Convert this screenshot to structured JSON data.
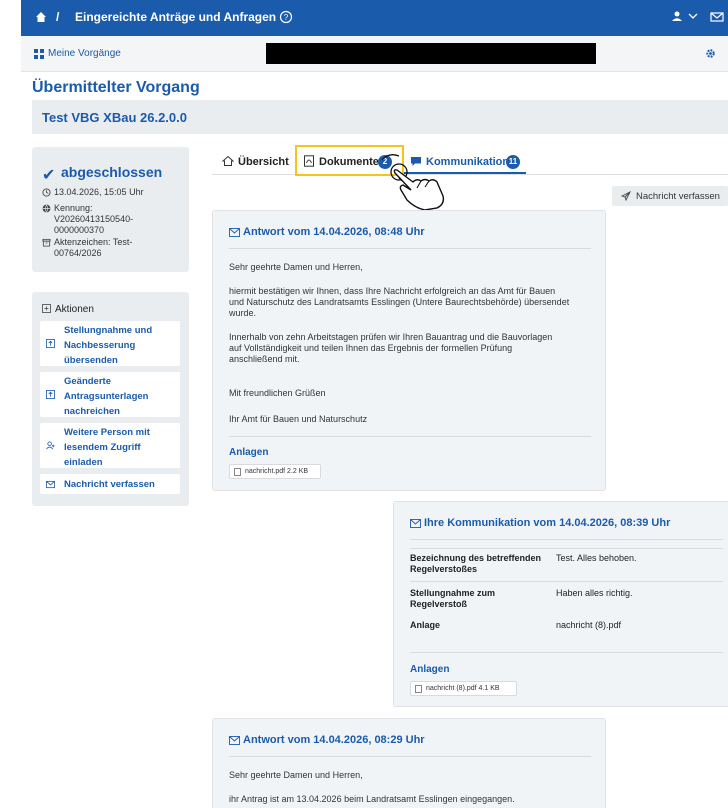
{
  "header": {
    "separator": "/",
    "breadcrumb": "Eingereichte Anträge und Anfragen"
  },
  "subnav": {
    "label": "Meine Vorgänge"
  },
  "page_title": "Übermittelter Vorgang",
  "vorgang_title": "Test VBG XBau 26.2.0.0",
  "status": {
    "label": "abgeschlossen",
    "date": "13.04.2026, 15:05 Uhr",
    "kennung": [
      "Kennung:",
      "V20260413150540-",
      "0000000370"
    ],
    "aktenzeichen": [
      "Aktenzeichen: Test-",
      "00764/2026"
    ]
  },
  "actions": {
    "title": "Aktionen",
    "items": [
      [
        "Stellungnahme und",
        "Nachbesserung",
        "übersenden"
      ],
      [
        "Geänderte",
        "Antragsunterlagen",
        "nachreichen"
      ],
      [
        "Weitere Person mit",
        "lesendem Zugriff",
        "einladen"
      ],
      [
        "Nachricht verfassen"
      ]
    ]
  },
  "tabs": {
    "overview": "Übersicht",
    "documents": "Dokumente",
    "documents_count": "2",
    "communication": "Kommunikation",
    "communication_count": "11"
  },
  "compose_button": "Nachricht verfassen",
  "messages": {
    "m1": {
      "title": "Antwort vom 14.04.2026, 08:48 Uhr",
      "lines": [
        "Sehr geehrte Damen und Herren,",
        "hiermit bestätigen wir Ihnen, dass Ihre Nachricht erfolgreich an das Amt für Bauen",
        "und Naturschutz des Landratsamts Esslingen (Untere Baurechtsbehörde) übersendet",
        "wurde.",
        "Innerhalb von zehn Arbeitstagen prüfen wir Ihren Bauantrag und die Bauvorlagen",
        "auf Vollständigkeit und teilen Ihnen das Ergebnis der formellen Prüfung",
        "anschließend mit.",
        "Mit freundlichen Grüßen",
        "Ihr Amt für Bauen und Naturschutz"
      ],
      "attachments_label": "Anlagen",
      "attachment": "nachricht.pdf 2.2 KB"
    },
    "m2": {
      "title": "Ihre Kommunikation vom 14.04.2026, 08:39 Uhr",
      "rows": [
        {
          "k": [
            "Bezeichnung des betreffenden",
            "Regelverstoßes"
          ],
          "v": "Test. Alles behoben."
        },
        {
          "k": [
            "Stellungnahme zum",
            "Regelverstoß"
          ],
          "v": "Haben alles richtig."
        },
        {
          "k": [
            "Anlage"
          ],
          "v": "nachricht (8).pdf"
        }
      ],
      "attachments_label": "Anlagen",
      "attachment": "nachricht (8).pdf 4.1 KB"
    },
    "m3": {
      "title": "Antwort vom 14.04.2026, 08:29 Uhr",
      "lines": [
        "Sehr geehrte Damen und Herren,",
        "ihr Antrag ist am 13.04.2026 beim Landratsamt Esslingen eingegangen."
      ]
    }
  },
  "colors": {
    "brand": "#1b5bab",
    "highlight": "#f5c518"
  }
}
